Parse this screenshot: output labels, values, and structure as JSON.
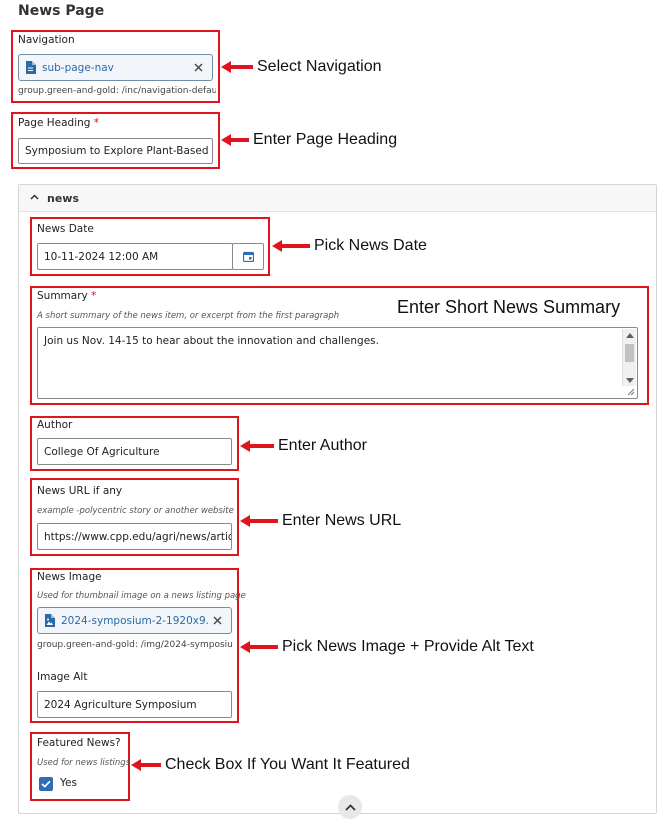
{
  "page_title": "News Page",
  "navigation": {
    "label": "Navigation",
    "value": "sub-page-nav",
    "path": "group.green-and-gold: /inc/navigation-defaul..."
  },
  "page_heading": {
    "label": "Page Heading",
    "required_mark": "*",
    "value": "Symposium to Explore Plant-Based Fo"
  },
  "news_section": {
    "title": "news",
    "news_date": {
      "label": "News Date",
      "value": "10-11-2024 12:00 AM"
    },
    "summary": {
      "label": "Summary",
      "required_mark": "*",
      "help": "A short summary of the news item, or excerpt from the first paragraph",
      "value": "Join us Nov. 14-15 to hear about the innovation and challenges."
    },
    "author": {
      "label": "Author",
      "value": "College Of Agriculture"
    },
    "news_url": {
      "label": "News URL if any",
      "help": "example -polycentric story or another website",
      "value": "https://www.cpp.edu/agri/news/articl"
    },
    "news_image": {
      "label": "News Image",
      "help": "Used for thumbnail image on a news listing page",
      "value": "2024-symposium-2-1920x9...",
      "path": "group.green-and-gold: /img/2024-symposiu...",
      "alt_label": "Image Alt",
      "alt_value": "2024 Agriculture Symposium"
    },
    "featured": {
      "label": "Featured News?",
      "help": "Used for news listings",
      "option": "Yes",
      "checked": true
    }
  },
  "annotations": {
    "navigation": "Select Navigation",
    "heading": "Enter Page Heading",
    "date": "Pick News Date",
    "summary": "Enter Short News Summary",
    "author": "Enter Author",
    "url": "Enter News URL",
    "image": "Pick News Image + Provide Alt Text",
    "featured": "Check Box If You Want It Featured"
  },
  "colors": {
    "highlight": "#e0141e",
    "accent": "#2f6db5",
    "link": "#2a6aa8"
  },
  "icons": {
    "file": "file-icon",
    "image_file": "image-file-icon",
    "clear": "close-icon",
    "calendar": "calendar-icon",
    "collapse": "chevron-up-icon",
    "checkmark": "checkmark-icon"
  }
}
